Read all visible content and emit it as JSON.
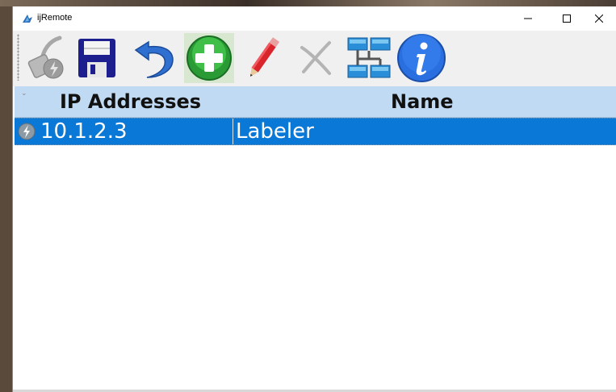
{
  "window": {
    "title": "ijRemote",
    "controls": {
      "minimize": "minimize",
      "maximize": "maximize",
      "close": "close"
    }
  },
  "toolbar": {
    "buttons": [
      {
        "name": "connect",
        "icon": "network-cable-icon",
        "enabled": false
      },
      {
        "name": "save",
        "icon": "floppy-disk-icon",
        "enabled": true
      },
      {
        "name": "undo",
        "icon": "undo-arrow-icon",
        "enabled": true
      },
      {
        "name": "add",
        "icon": "green-plus-icon",
        "enabled": true
      },
      {
        "name": "edit",
        "icon": "red-pencil-icon",
        "enabled": true
      },
      {
        "name": "delete",
        "icon": "gray-x-icon",
        "enabled": false
      },
      {
        "name": "network",
        "icon": "network-topology-icon",
        "enabled": true
      },
      {
        "name": "info",
        "icon": "info-icon",
        "enabled": true
      }
    ]
  },
  "table": {
    "columns": [
      "IP Addresses",
      "Name"
    ],
    "rows": [
      {
        "ip": "10.1.2.3",
        "name": "Labeler",
        "selected": true
      }
    ]
  },
  "colors": {
    "header_bg": "#bfdaf2",
    "selection": "#0a78d7",
    "toolbar_bg": "#f0f0f0"
  }
}
